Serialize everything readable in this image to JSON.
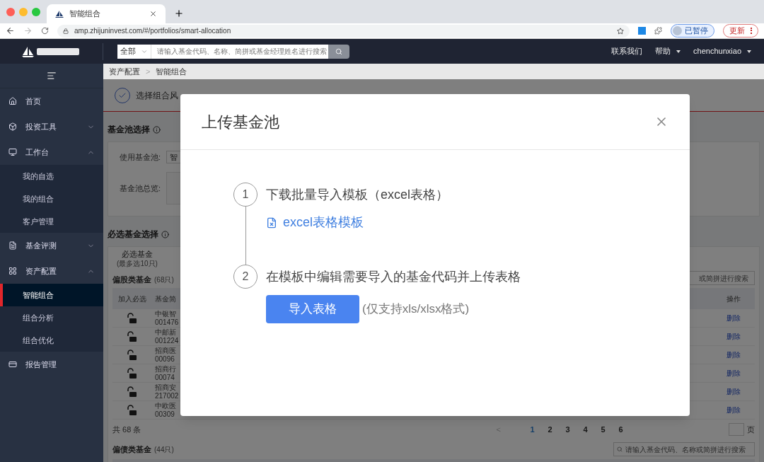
{
  "browser": {
    "tab_title": "智能组合",
    "url": "amp.zhijuninvest.com/#/portfolios/smart-allocation",
    "profile_label": "已暂停",
    "update_label": "更新"
  },
  "header": {
    "search_scope": "全部",
    "search_placeholder": "请输入基金代码、名称、简拼或基金经理姓名进行搜索",
    "links": [
      {
        "label": "联系我们",
        "dropdown": false
      },
      {
        "label": "帮助",
        "dropdown": true
      },
      {
        "label": "chenchunxiao",
        "dropdown": true
      }
    ]
  },
  "sidebar": {
    "items": [
      {
        "label": "首页",
        "kind": "link"
      },
      {
        "label": "投资工具",
        "kind": "group",
        "expanded": false
      },
      {
        "label": "工作台",
        "kind": "group",
        "expanded": true,
        "children": [
          {
            "label": "我的自选",
            "selected": false
          },
          {
            "label": "我的组合",
            "selected": false
          },
          {
            "label": "客户管理",
            "selected": false
          }
        ]
      },
      {
        "label": "基金评测",
        "kind": "group",
        "expanded": false
      },
      {
        "label": "资产配置",
        "kind": "group",
        "expanded": true,
        "children": [
          {
            "label": "智能组合",
            "selected": true
          },
          {
            "label": "组合分析",
            "selected": false
          },
          {
            "label": "组合优化",
            "selected": false
          }
        ]
      },
      {
        "label": "报告管理",
        "kind": "link"
      }
    ]
  },
  "breadcrumb": {
    "items": [
      "资产配置",
      "智能组合"
    ],
    "separator": ">"
  },
  "step": {
    "label": "选择组合风",
    "checked": true
  },
  "pool_section": {
    "title": "基金池选择",
    "fields": [
      {
        "label": "使用基金池:",
        "value": "智"
      },
      {
        "label": "基金池总览:"
      }
    ]
  },
  "required_section": {
    "title": "必选基金选择",
    "tab": {
      "label": "必选基金",
      "note": "(最多选10只)"
    },
    "stock_funds": {
      "title": "偏股类基金",
      "count": "(68只)",
      "search_placeholder": "或简拼进行搜索",
      "columns": [
        "加入必选",
        "基金简",
        "操作"
      ],
      "rows": [
        {
          "locked": false,
          "name": "中银智",
          "code": "001476",
          "action": "删除"
        },
        {
          "locked": false,
          "name": "中邮新",
          "code": "001224",
          "action": "删除"
        },
        {
          "locked": false,
          "name": "招商医",
          "code": "00096",
          "action": "删除"
        },
        {
          "locked": false,
          "name": "招商行",
          "code": "00074",
          "action": "删除"
        },
        {
          "locked": false,
          "name": "招商安",
          "code": "217002",
          "action": "删除"
        },
        {
          "locked": false,
          "name": "中欧医",
          "code": "00309",
          "action": "删除"
        }
      ],
      "total": "共 68 条",
      "prev": "<",
      "pages": [
        {
          "label": "1",
          "selected": true
        },
        {
          "label": "2",
          "selected": false
        },
        {
          "label": "3",
          "selected": false
        },
        {
          "label": "4",
          "selected": false
        },
        {
          "label": "5",
          "selected": false
        },
        {
          "label": "6",
          "selected": false
        }
      ],
      "page_suffix": "页"
    },
    "bond_funds": {
      "title": "偏债类基金",
      "count": "(44只)",
      "search_placeholder": "请输入基金代码、名称或简拼进行搜索"
    }
  },
  "modal": {
    "title": "上传基金池",
    "steps": [
      {
        "number": "1",
        "text": "下载批量导入模板（excel表格）",
        "kind": "link",
        "action": "excel表格模板"
      },
      {
        "number": "2",
        "text": "在模板中编辑需要导入的基金代码并上传表格",
        "kind": "button",
        "action": "导入表格",
        "note": "(仅支持xls/xlsx格式)"
      }
    ]
  }
}
